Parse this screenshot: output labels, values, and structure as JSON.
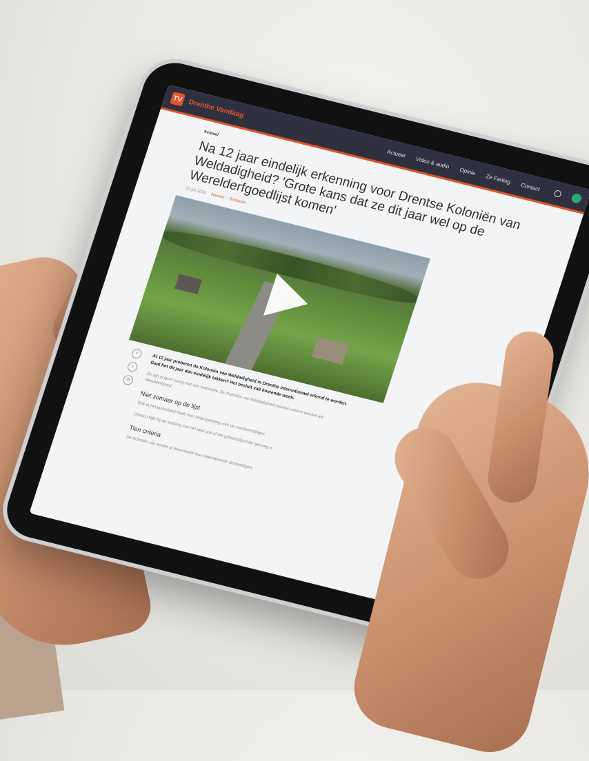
{
  "app": {
    "logo_text": "TV",
    "brand": "Drenthe Vandaag"
  },
  "nav": {
    "items": [
      "Actueel",
      "Video & audio",
      "Opinie",
      "Ze Farting",
      "Contact"
    ]
  },
  "article": {
    "breadcrumb_home": "Actueel",
    "title": "Na 12 jaar eindelijk erkenning voor Drentse Koloniën van Weldadigheid? 'Grote kans dat ze dit jaar wel op de Werelderfgoedlijst komen'",
    "date": "20 juli 2020",
    "tag": "Nieuws",
    "author": "Redactie",
    "lead": "Al 12 jaar proberen de Koloniën van Weldadigheid in Drenthe internationaal erkend te worden. Gaat het dit jaar dan eindelijk lukken? Het besluit valt komende week.",
    "paragraphs": [
      "Ze zijn al jaren bezig met een nominatie. De Koloniën van Weldadigheid moeten erkend worden als Werelderfgoed.",
      "Ook in het buitenland heeft men belangstelling voor de voorbereidingen.",
      "Unesco kijkt bij de toetsing van het land ook of het gebied bijzonder genoeg is.",
      "De Koloniën zijn eerder al beoordeeld door internationale deskundigen."
    ],
    "h2_1": "Niet zomaar op de lijst",
    "h2_2": "Tien criteria",
    "share": [
      "f",
      "t",
      "m"
    ]
  }
}
